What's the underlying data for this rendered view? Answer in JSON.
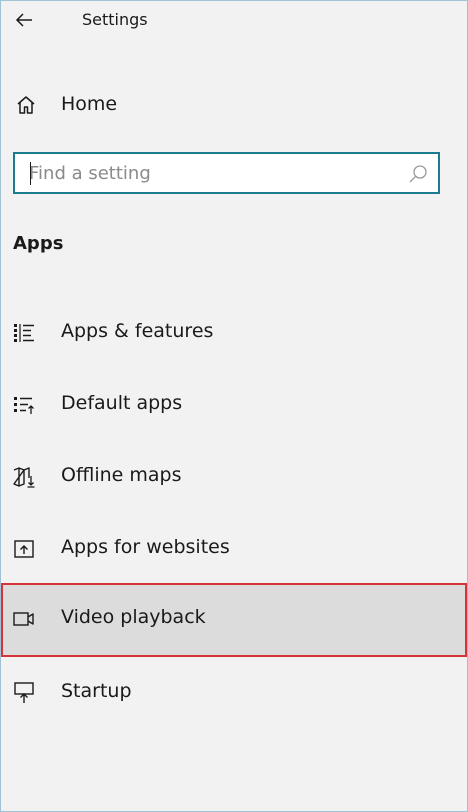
{
  "window": {
    "title": "Settings"
  },
  "home": {
    "label": "Home"
  },
  "search": {
    "value": "",
    "placeholder": "Find a setting"
  },
  "section": {
    "heading": "Apps"
  },
  "nav": {
    "items": [
      {
        "label": "Apps & features",
        "icon": "apps-features-icon"
      },
      {
        "label": "Default apps",
        "icon": "default-apps-icon"
      },
      {
        "label": "Offline maps",
        "icon": "offline-maps-icon"
      },
      {
        "label": "Apps for websites",
        "icon": "apps-websites-icon"
      },
      {
        "label": "Video playback",
        "icon": "video-playback-icon",
        "selected": true
      },
      {
        "label": "Startup",
        "icon": "startup-icon"
      }
    ]
  },
  "colors": {
    "search_border": "#1d7b8f",
    "selection_outline": "#d7333b",
    "selected_background": "#dcdcdc",
    "background": "#f2f2f2"
  }
}
